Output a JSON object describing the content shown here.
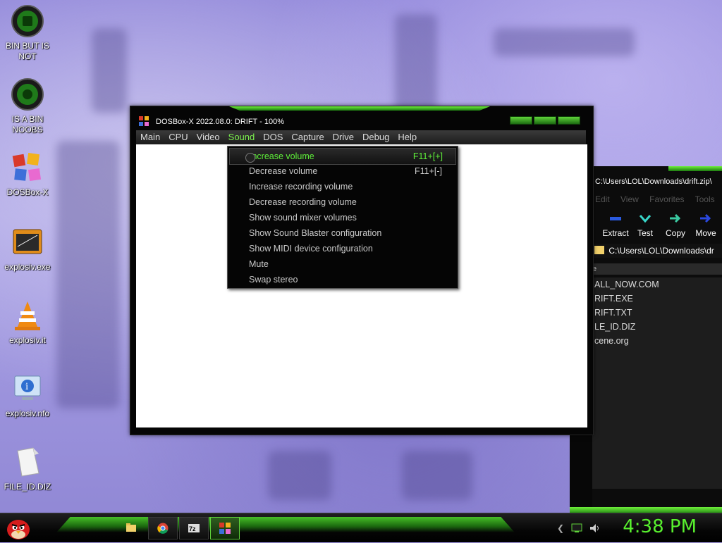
{
  "desktop": {
    "icons": [
      {
        "label": "BIN BUT IS NOT",
        "icon": "green-orb-icon"
      },
      {
        "label": "IS A BIN NOOBS",
        "icon": "green-orb-icon"
      },
      {
        "label": "DOSBox-X",
        "icon": "dosbox-logo-icon"
      },
      {
        "label": "explosiv.exe",
        "icon": "exe-window-icon"
      },
      {
        "label": "explosiv.it",
        "icon": "vlc-cone-icon"
      },
      {
        "label": "explosiv.nfo",
        "icon": "info-monitor-icon"
      },
      {
        "label": "FILE_ID.DIZ",
        "icon": "document-icon"
      }
    ]
  },
  "dosbox": {
    "title": "DOSBox-X 2022.08.0: DRIFT - 100%",
    "menu": [
      "Main",
      "CPU",
      "Video",
      "Sound",
      "DOS",
      "Capture",
      "Drive",
      "Debug",
      "Help"
    ],
    "active_menu": "Sound",
    "sound_menu": [
      {
        "label": "Increase volume",
        "shortcut": "F11+[+]",
        "highlighted": true
      },
      {
        "label": "Decrease volume",
        "shortcut": "F11+[-]"
      },
      {
        "label": "Increase recording volume",
        "shortcut": ""
      },
      {
        "label": "Decrease recording volume",
        "shortcut": ""
      },
      {
        "label": "Show sound mixer volumes",
        "shortcut": ""
      },
      {
        "label": "Show Sound Blaster configuration",
        "shortcut": ""
      },
      {
        "label": "Show MIDI device configuration",
        "shortcut": ""
      },
      {
        "label": "Mute",
        "shortcut": ""
      },
      {
        "label": "Swap stereo",
        "shortcut": ""
      }
    ]
  },
  "sevenzip": {
    "title": "C:\\Users\\LOL\\Downloads\\drift.zip\\",
    "menu": "Edit View Favorites Tools",
    "tools": [
      "Extract",
      "Test",
      "Copy",
      "Move"
    ],
    "address": "C:\\Users\\LOL\\Downloads\\dr",
    "column_name": "e",
    "files": [
      "ALL_NOW.COM",
      "RIFT.EXE",
      "RIFT.TXT",
      "LE_ID.DIZ",
      "cene.org"
    ]
  },
  "taskbar": {
    "clock": "4:38 PM",
    "accent": "#58f02e"
  }
}
